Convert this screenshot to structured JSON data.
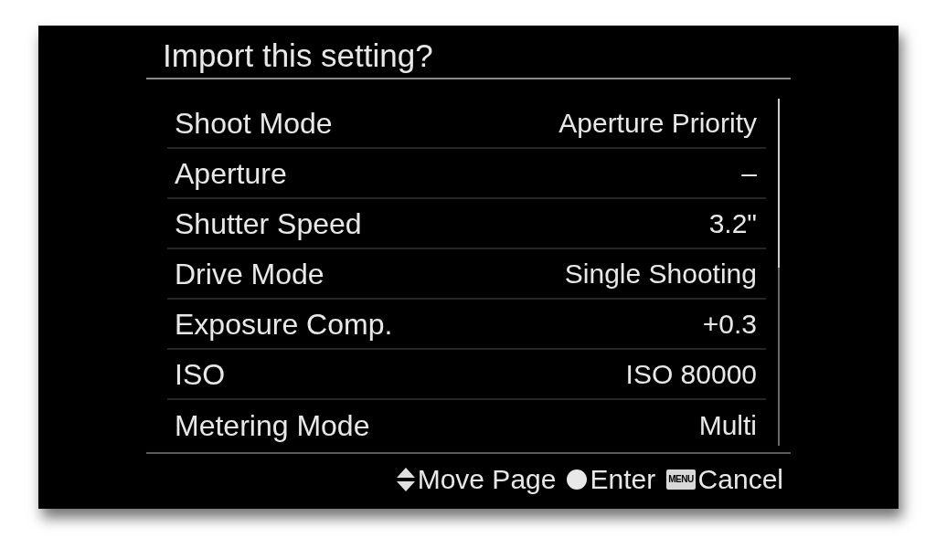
{
  "dialog": {
    "title": "Import this setting?"
  },
  "settings": [
    {
      "label": "Shoot Mode",
      "value": "Aperture Priority"
    },
    {
      "label": "Aperture",
      "value": "–"
    },
    {
      "label": "Shutter Speed",
      "value": "3.2\""
    },
    {
      "label": "Drive Mode",
      "value": "Single Shooting"
    },
    {
      "label": "Exposure Comp.",
      "value": "+0.3"
    },
    {
      "label": "ISO",
      "value": "ISO 80000"
    },
    {
      "label": "Metering Mode",
      "value": "Multi"
    }
  ],
  "footer_hints": [
    {
      "kind": "updown",
      "label": "Move Page"
    },
    {
      "kind": "dot",
      "label": "Enter"
    },
    {
      "kind": "key",
      "key": "MENU",
      "label": "Cancel"
    }
  ]
}
